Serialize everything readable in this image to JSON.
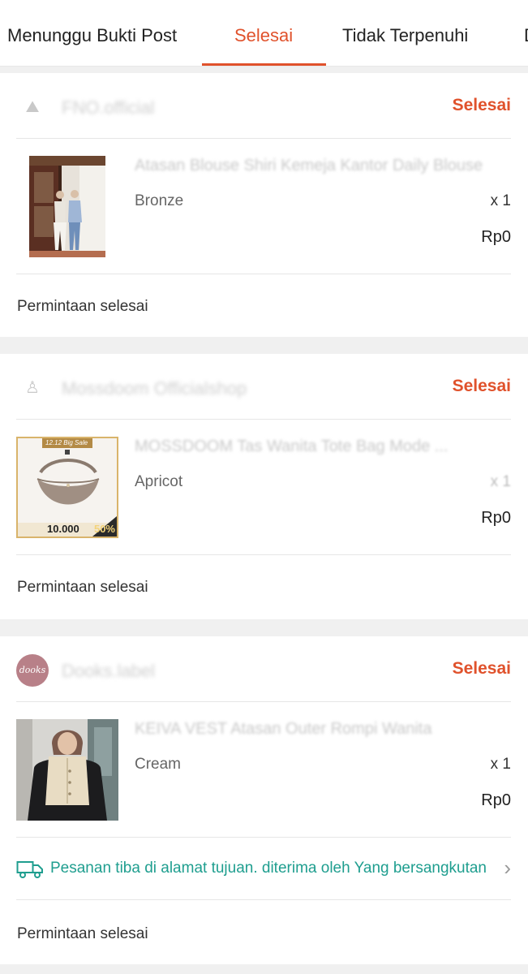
{
  "tabs": [
    {
      "label": "Menunggu Bukti Post"
    },
    {
      "label": "Selesai"
    },
    {
      "label": "Tidak Terpenuhi"
    },
    {
      "label": "D"
    }
  ],
  "colors": {
    "accent": "#e0522c",
    "delivery": "#1f9e8f",
    "background": "#f0f0f0"
  },
  "orders": [
    {
      "shop_icon": "shop-icon",
      "shop_name": "FNO.official",
      "status": "Selesai",
      "product_name": "Atasan Blouse Shiri Kemeja Kantor Daily Blouse",
      "variant": "Bronze",
      "qty": "x 1",
      "price": "Rp0",
      "footer": "Permintaan selesai"
    },
    {
      "shop_icon": "shop-icon",
      "shop_name": "Mossdoom Officialshop",
      "status": "Selesai",
      "product_name": "MOSSDOOM Tas Wanita Tote Bag Mode ...",
      "badge_top": "12.12 Big Sale",
      "badge_price": "10.000",
      "badge_percent": "50%",
      "variant": "Apricot",
      "qty": "x 1",
      "price": "Rp0",
      "footer": "Permintaan selesai"
    },
    {
      "shop_icon": "avatar",
      "shop_name": "Dooks.label",
      "avatar_text": "dooks",
      "status": "Selesai",
      "product_name": "KEIVA VEST Atasan Outer Rompi Wanita",
      "variant": "Cream",
      "qty": "x 1",
      "price": "Rp0",
      "delivery": {
        "icon": "truck-icon",
        "text": "Pesanan tiba di alamat tujuan. diterima oleh Yang bersangkutan"
      },
      "footer": "Permintaan selesai"
    }
  ]
}
